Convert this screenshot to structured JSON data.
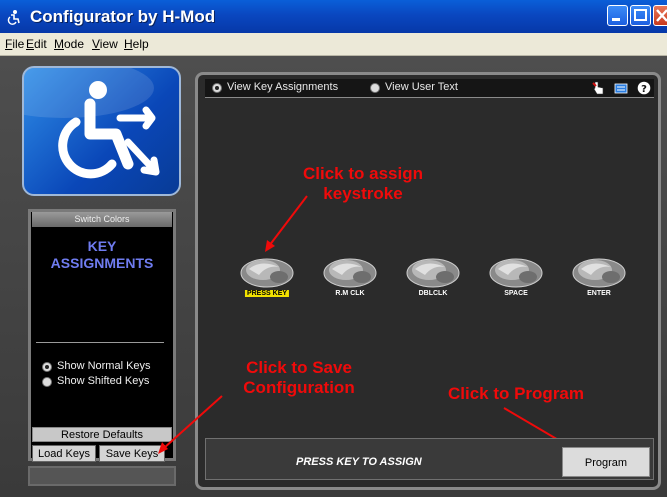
{
  "window": {
    "title": "Configurator by H-Mod"
  },
  "menu": {
    "items": [
      {
        "accel": "F",
        "rest": "ile"
      },
      {
        "accel": "E",
        "rest": "dit"
      },
      {
        "accel": "M",
        "rest": "ode"
      },
      {
        "accel": "V",
        "rest": "iew"
      },
      {
        "accel": "H",
        "rest": "elp"
      }
    ]
  },
  "left_panel": {
    "switch_colors_title": "Switch Colors",
    "heading_line1": "KEY",
    "heading_line2": "ASSIGNMENTS",
    "options": [
      {
        "label": "Show Normal Keys",
        "selected": true
      },
      {
        "label": "Show Shifted Keys",
        "selected": false
      }
    ],
    "restore_defaults": "Restore Defaults",
    "load_keys": "Load Keys",
    "save_keys": "Save Keys"
  },
  "view": {
    "options": [
      {
        "label": "View Key Assignments",
        "selected": true
      },
      {
        "label": "View User Text",
        "selected": false
      }
    ],
    "toolbar_icons": [
      "pointer-hand-icon",
      "message-icon",
      "help-icon"
    ]
  },
  "keys": [
    {
      "label": "PRESS KEY",
      "highlight": true
    },
    {
      "label": "R.M CLK",
      "highlight": false
    },
    {
      "label": "DBLCLK",
      "highlight": false
    },
    {
      "label": "SPACE",
      "highlight": false
    },
    {
      "label": "ENTER",
      "highlight": false
    }
  ],
  "annotations": {
    "assign_line1": "Click to assign",
    "assign_line2": "keystroke",
    "save_line1": "Click to Save",
    "save_line2": "Configuration",
    "program": "Click to Program"
  },
  "status": {
    "text": "PRESS KEY TO ASSIGN",
    "program_button": "Program"
  },
  "colors": {
    "annotation_red": "#f00a0a",
    "heading_blue": "#6f7cf0",
    "highlight_yellow": "#f2e200"
  }
}
